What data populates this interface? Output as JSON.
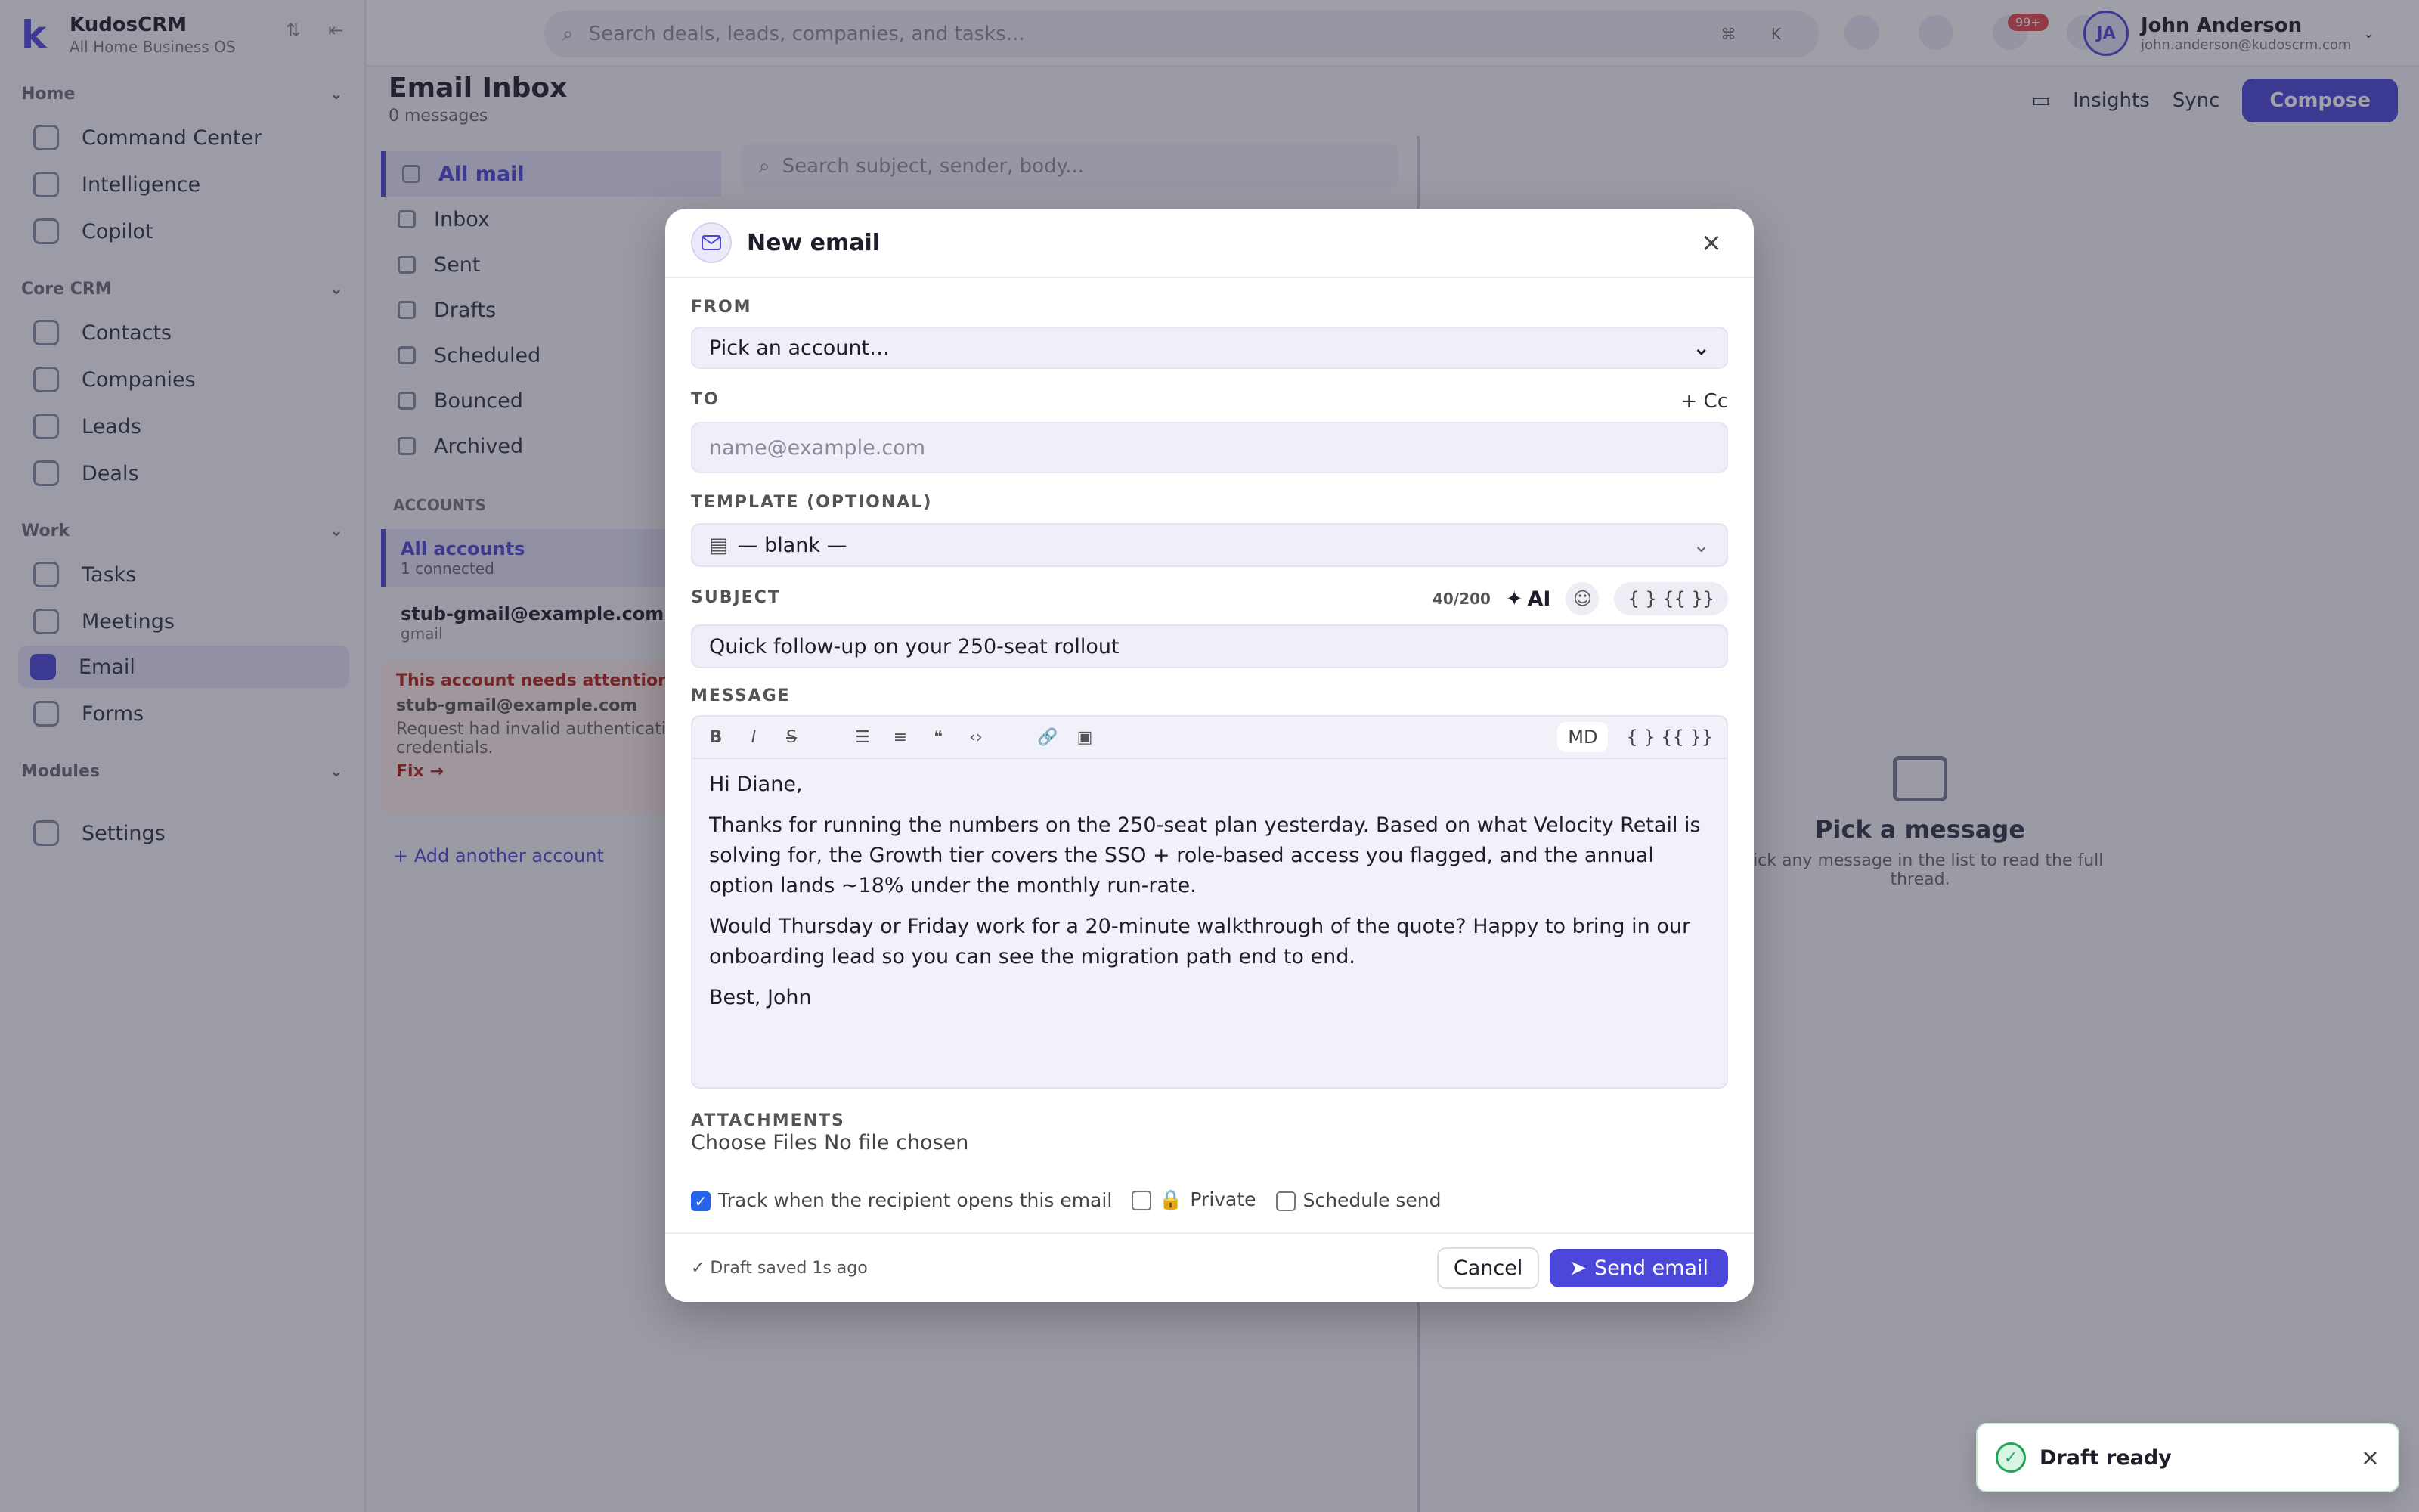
{
  "brand": {
    "name": "KudosCRM",
    "sub": "All Home Business OS"
  },
  "sidebar": {
    "sections": [
      {
        "label": "Home",
        "items": [
          "Command Center",
          "Intelligence",
          "Copilot"
        ]
      },
      {
        "label": "Core CRM",
        "items": [
          "Contacts",
          "Companies",
          "Leads",
          "Deals"
        ]
      },
      {
        "label": "Work",
        "items": [
          "Tasks",
          "Meetings",
          "Email",
          "Forms"
        ]
      },
      {
        "label": "Modules",
        "items": []
      }
    ],
    "settings": "Settings",
    "active_item": "Email"
  },
  "topbar": {
    "search_placeholder": "Search deals, leads, companies, and tasks...",
    "search_kbd": "⌘ K",
    "notif_badge": "99+",
    "user_initials": "JA",
    "user_name": "John Anderson",
    "user_email": "john.anderson@kudoscrm.com"
  },
  "page": {
    "title": "Email Inbox",
    "subtitle": "0 messages",
    "actions": {
      "insights": "Insights",
      "sync": "Sync",
      "compose": "Compose"
    }
  },
  "folders": [
    "All mail",
    "Inbox",
    "Sent",
    "Drafts",
    "Scheduled",
    "Bounced",
    "Archived"
  ],
  "accounts": {
    "label": "ACCOUNTS",
    "all": {
      "title": "All accounts",
      "sub": "1 connected"
    },
    "account": {
      "email": "stub-gmail@example.com",
      "provider": "gmail"
    },
    "warning": {
      "title": "This account needs attention",
      "email": "stub-gmail@example.com",
      "detail": "Request had invalid authentication credentials.",
      "fix": "Fix →"
    },
    "add": "+ Add another account"
  },
  "list": {
    "search_placeholder": "Search subject, sender, body..."
  },
  "empty": {
    "title": "Pick a message",
    "sub": "Click any message in the list to read the full thread."
  },
  "modal": {
    "title": "New email",
    "from_label": "FROM",
    "from_value": "Pick an account…",
    "to_label": "TO",
    "to_placeholder": "name@example.com",
    "cc_link": "+ Cc",
    "template_label": "TEMPLATE (OPTIONAL)",
    "template_value": "— blank —",
    "subject_label": "SUBJECT",
    "subject_counter": "40/200",
    "ai_label": "AI",
    "vars_label": "{ } {{ }}",
    "subject_value": "Quick follow-up on your 250-seat rollout",
    "message_label": "MESSAGE",
    "md_label": "MD",
    "body": {
      "p1": "Hi Diane,",
      "p2": "Thanks for running the numbers on the 250-seat plan yesterday. Based on what Velocity Retail is solving for, the Growth tier covers the SSO + role-based access you flagged, and the annual option lands ~18% under the monthly run-rate.",
      "p3": "Would Thursday or Friday work for a 20-minute walkthrough of the quote? Happy to bring in our onboarding lead so you can see the migration path end to end.",
      "p4": "Best, John"
    },
    "attachments_label": "ATTACHMENTS",
    "attachments_value": "Choose Files No file chosen",
    "opt_track": "Track when the recipient opens this email",
    "opt_private": "Private",
    "opt_schedule": "Schedule send",
    "saved": "✓ Draft saved 1s ago",
    "cancel": "Cancel",
    "send": "Send email"
  },
  "toast": {
    "title": "Draft ready"
  },
  "colors": {
    "accent": "#4b47d8",
    "success": "#22a55a",
    "danger": "#e5484d"
  }
}
